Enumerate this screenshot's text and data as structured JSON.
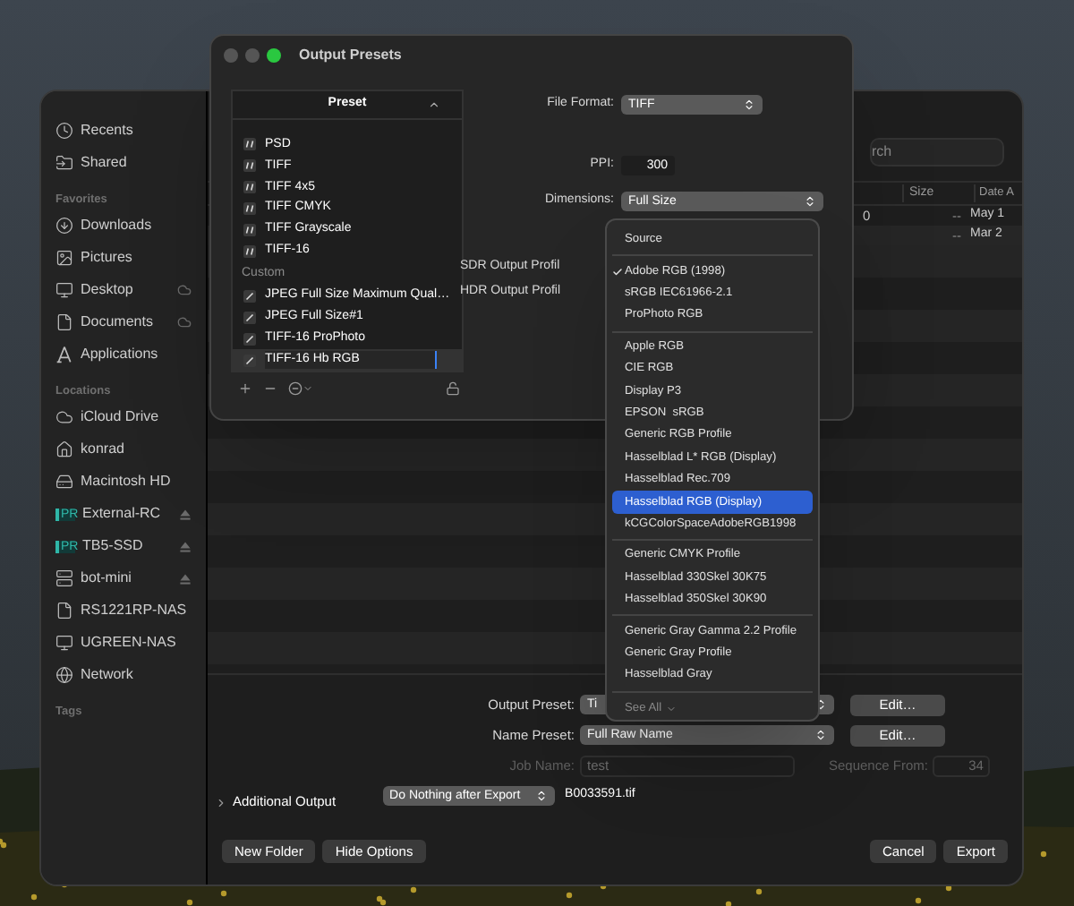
{
  "save_dialog": {
    "sidebar": {
      "sections": [
        {
          "items": [
            {
              "label": "Recents",
              "cloud": false,
              "ejectable": false
            },
            {
              "label": "Shared",
              "cloud": false,
              "ejectable": false
            }
          ]
        },
        {
          "title": "Favorites",
          "items": [
            {
              "label": "Downloads",
              "cloud": false,
              "ejectable": false
            },
            {
              "label": "Pictures",
              "cloud": false,
              "ejectable": false
            },
            {
              "label": "Desktop",
              "cloud": true,
              "ejectable": false
            },
            {
              "label": "Documents",
              "cloud": true,
              "ejectable": false
            },
            {
              "label": "Applications",
              "cloud": false,
              "ejectable": false
            }
          ]
        },
        {
          "title": "Locations",
          "items": [
            {
              "label": "iCloud Drive",
              "cloud": false,
              "ejectable": false
            },
            {
              "label": "konrad",
              "cloud": false,
              "ejectable": false
            },
            {
              "label": "Macintosh HD",
              "cloud": false,
              "ejectable": false
            },
            {
              "label": "External-RC",
              "badge": "PR",
              "cloud": false,
              "ejectable": true
            },
            {
              "label": "TB5-SSD",
              "badge": "PR",
              "cloud": false,
              "ejectable": true
            },
            {
              "label": "bot-mini",
              "cloud": false,
              "ejectable": true
            },
            {
              "label": "RS1221RP-NAS",
              "cloud": false,
              "ejectable": false
            },
            {
              "label": "UGREEN-NAS",
              "cloud": false,
              "ejectable": false
            },
            {
              "label": "Network",
              "cloud": false,
              "ejectable": false
            }
          ]
        },
        {
          "title": "Tags"
        }
      ]
    },
    "search": {
      "placeholder": "rch"
    },
    "table": {
      "columns": [
        "Size",
        "Date A"
      ],
      "rows": [
        {
          "name": "0",
          "size": "--",
          "date": "May 1"
        },
        {
          "name": "",
          "size": "--",
          "date": "Mar 2"
        }
      ]
    },
    "options": {
      "output_preset": {
        "label": "Output Preset:",
        "value": "Ti",
        "button": "Edit…"
      },
      "name_preset": {
        "label": "Name Preset:",
        "value": "Full Raw Name",
        "button": "Edit…"
      },
      "job_name": {
        "label": "Job Name:",
        "value": "test",
        "disabled": true
      },
      "sequence": {
        "label": "Sequence From:",
        "value": "34",
        "disabled": true
      },
      "additional_output": {
        "label": "Additional Output",
        "expanded": false
      },
      "after_export": {
        "value": "Do Nothing after Export"
      },
      "filename": "B0033591.tif"
    },
    "buttons_left": [
      "New Folder",
      "Hide Options"
    ],
    "buttons_right": [
      {
        "label": "Cancel",
        "default": false
      },
      {
        "label": "Export",
        "default": false
      }
    ]
  },
  "presets_window": {
    "title": "Output Presets",
    "list": {
      "header": "Preset",
      "items": [
        {
          "kind": "builtin",
          "label": "PSD",
          "selected": false,
          "editing": false
        },
        {
          "kind": "builtin",
          "label": "TIFF",
          "selected": false,
          "editing": false
        },
        {
          "kind": "builtin",
          "label": "TIFF 4x5",
          "selected": false,
          "editing": false
        },
        {
          "kind": "builtin",
          "label": "TIFF CMYK",
          "selected": false,
          "editing": false
        },
        {
          "kind": "builtin",
          "label": "TIFF Grayscale",
          "selected": false,
          "editing": false
        },
        {
          "kind": "builtin",
          "label": "TIFF-16",
          "selected": false,
          "editing": false
        },
        {
          "kind": "section",
          "label": "Custom"
        },
        {
          "kind": "custom",
          "label": "JPEG Full Size Maximum Qual…",
          "selected": false,
          "editing": false
        },
        {
          "kind": "custom",
          "label": "JPEG Full Size#1",
          "selected": false,
          "editing": false
        },
        {
          "kind": "custom",
          "label": "TIFF-16 ProPhoto",
          "selected": false,
          "editing": false
        },
        {
          "kind": "custom",
          "label": "TIFF-16 Hb RGB",
          "selected": true,
          "editing": true
        }
      ]
    },
    "file_format": {
      "label": "File Format:",
      "value": "TIFF"
    },
    "ppi": {
      "label": "PPI:",
      "value": "300"
    },
    "dimensions": {
      "label": "Dimensions:",
      "value": "Full Size"
    },
    "sdr_profile": {
      "label": "SDR Output Profil"
    },
    "hdr_profile": {
      "label": "HDR Output Profil"
    }
  },
  "profile_menu": {
    "sections": [
      [
        {
          "label": "Source",
          "checked": false,
          "highlighted": false
        }
      ],
      [
        {
          "label": "Adobe RGB (1998)",
          "checked": true,
          "highlighted": false
        },
        {
          "label": "sRGB IEC61966-2.1",
          "checked": false,
          "highlighted": false
        },
        {
          "label": "ProPhoto RGB",
          "checked": false,
          "highlighted": false
        }
      ],
      [
        {
          "label": "Apple RGB",
          "checked": false,
          "highlighted": false
        },
        {
          "label": "CIE RGB",
          "checked": false,
          "highlighted": false
        },
        {
          "label": "Display P3",
          "checked": false,
          "highlighted": false
        },
        {
          "label": "EPSON  sRGB",
          "checked": false,
          "highlighted": false
        },
        {
          "label": "Generic RGB Profile",
          "checked": false,
          "highlighted": false
        },
        {
          "label": "Hasselblad L* RGB (Display)",
          "checked": false,
          "highlighted": false
        },
        {
          "label": "Hasselblad Rec.709",
          "checked": false,
          "highlighted": false
        },
        {
          "label": "Hasselblad RGB (Display)",
          "checked": false,
          "highlighted": true
        },
        {
          "label": "kCGColorSpaceAdobeRGB1998",
          "checked": false,
          "highlighted": false
        }
      ],
      [
        {
          "label": "Generic CMYK Profile",
          "checked": false,
          "highlighted": false
        },
        {
          "label": "Hasselblad 330Skel 30K75",
          "checked": false,
          "highlighted": false
        },
        {
          "label": "Hasselblad 350Skel 30K90",
          "checked": false,
          "highlighted": false
        }
      ],
      [
        {
          "label": "Generic Gray Gamma 2.2 Profile",
          "checked": false,
          "highlighted": false
        },
        {
          "label": "Generic Gray Profile",
          "checked": false,
          "highlighted": false
        },
        {
          "label": "Hasselblad Gray",
          "checked": false,
          "highlighted": false
        }
      ]
    ],
    "footer": "See All"
  }
}
